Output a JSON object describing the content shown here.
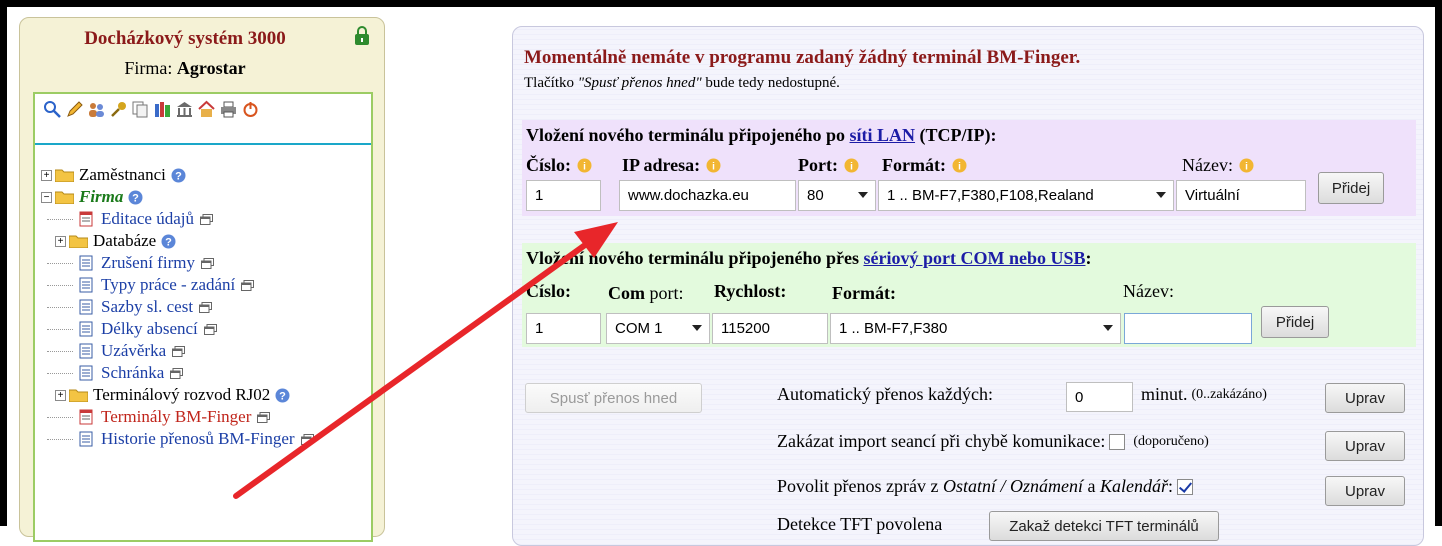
{
  "sidebar": {
    "title": "Docházkový systém 3000",
    "company_prefix": "Firma: ",
    "company_name": "Agrostar",
    "tree": {
      "zamestnanci": "Zaměstnanci",
      "firma": "Firma",
      "editace": "Editace údajů",
      "databaze": "Databáze",
      "zruseni": "Zrušení firmy",
      "typy": "Typy práce - zadání",
      "sazby": "Sazby sl. cest",
      "delky": "Délky absencí",
      "uzaverka": "Uzávěrka",
      "schranka": "Schránka",
      "terminal_rozvod": "Terminálový rozvod RJ02",
      "terminaly": "Terminály BM-Finger",
      "historie": "Historie přenosů BM-Finger"
    }
  },
  "main": {
    "warning_title": "Momentálně nemáte v programu zadaný žádný terminál BM-Finger.",
    "warning_prefix": "Tlačítko ",
    "warning_button_ref": "\"Spusť přenos hned\"",
    "warning_suffix": " bude tedy nedostupné.",
    "lan": {
      "heading_prefix": "Vložení nového terminálu připojeného po ",
      "heading_link": "síti LAN",
      "heading_suffix": " (TCP/IP):",
      "label_cislo": "Číslo:",
      "label_ip": "IP adresa:",
      "label_port": "Port:",
      "label_format": "Formát:",
      "label_nazev": "Název:",
      "cislo": "1",
      "ip": "www.dochazka.eu",
      "port": "80",
      "format": "1 .. BM-F7,F380,F108,Realand",
      "nazev": "Virtuální",
      "add_button": "Přidej"
    },
    "com": {
      "heading_prefix": "Vložení nového terminálu připojeného přes ",
      "heading_link": "sériový port COM nebo USB",
      "heading_suffix": ":",
      "label_cislo": "Číslo:",
      "label_com": "Com",
      "label_port": " port:",
      "label_rychlost": "Rychlost:",
      "label_format": "Formát:",
      "label_nazev": "Název:",
      "cislo": "1",
      "com": "COM 1",
      "rychlost": "115200",
      "format": "1 .. BM-F7,F380",
      "nazev": "",
      "add_button": "Přidej"
    },
    "transfer_button": "Spusť přenos hned",
    "auto_label": "Automatický přenos každých:",
    "auto_value": "0",
    "auto_unit": "minut.",
    "auto_note": "(0..zakázáno)",
    "import_label": "Zakázat import seancí při chybě komunikace:",
    "import_note": "(doporučeno)",
    "msg_label_prefix": "Povolit přenos zpráv z ",
    "msg_label_italic1": "Ostatní / Oznámení",
    "msg_label_mid": " a ",
    "msg_label_italic2": "Kalendář",
    "msg_label_suffix": ":",
    "tft_label": "Detekce TFT povolena",
    "tft_button": "Zakaž detekci TFT terminálů",
    "upraw_button": "Uprav"
  },
  "colors": {
    "title_red": "#8b1a1a",
    "link_blue": "#1c1ca6",
    "lan_bg": "#efe1fb",
    "com_bg": "#e3fadd",
    "arrow": "#e8262a"
  }
}
